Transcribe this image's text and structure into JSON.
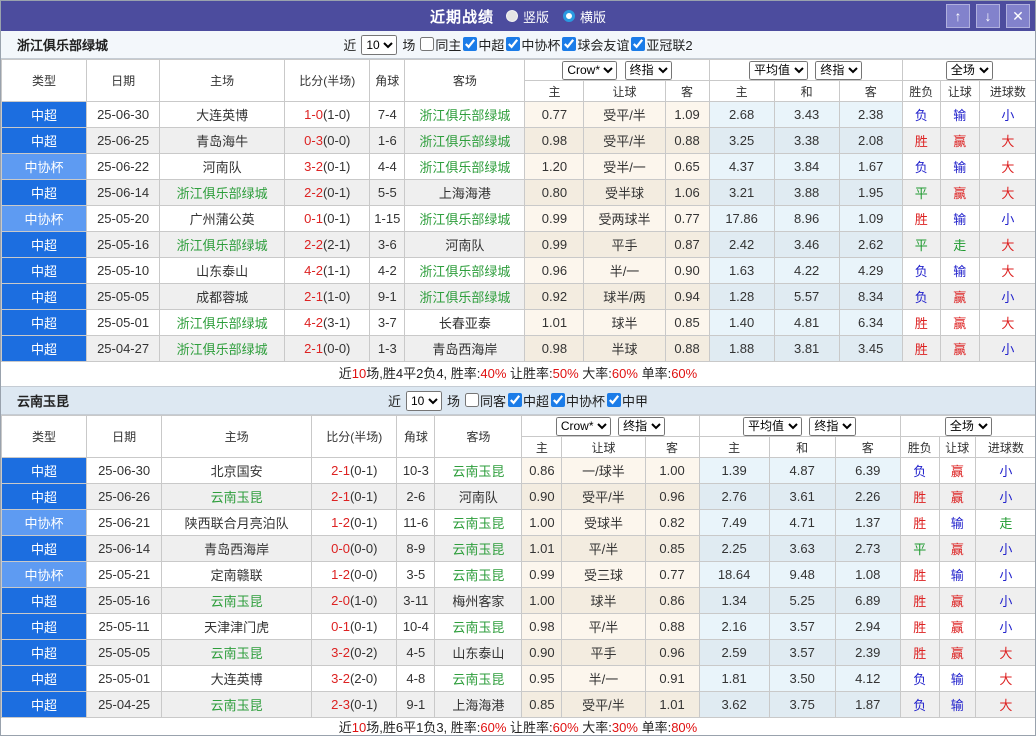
{
  "titlebar": {
    "title": "近期战绩",
    "view_options": [
      {
        "label": "竖版",
        "selected": true
      },
      {
        "label": "横版",
        "selected": false
      }
    ],
    "up_icon": "↑",
    "down_icon": "↓",
    "close_icon": "✕"
  },
  "table_header": {
    "cols": [
      "类型",
      "日期",
      "主场",
      "比分(半场)",
      "角球",
      "客场"
    ],
    "odds_sub": [
      "主",
      "让球",
      "客"
    ],
    "avg_sub": [
      "主",
      "和",
      "客"
    ],
    "result_sub": [
      "胜负",
      "让球",
      "进球数"
    ]
  },
  "colors": {
    "titlebar": "#4c4c9e",
    "league_csl": "#1c6ee0",
    "league_cup": "#5e9bf2",
    "win_red": "#dd2222",
    "lose_blue": "#2222cc",
    "draw_green": "#1f9a2f",
    "focus_team_green": "#2e9e3c"
  },
  "sections": [
    {
      "team": "浙江俱乐部绿城",
      "filter": {
        "near_label": "近",
        "count": "10",
        "unit_label": "场",
        "checkboxes": [
          {
            "label": "同主",
            "checked": false
          },
          {
            "label": "中超",
            "checked": true
          },
          {
            "label": "中协杯",
            "checked": true
          },
          {
            "label": "球会友谊",
            "checked": true
          },
          {
            "label": "亚冠联2",
            "checked": true
          }
        ]
      },
      "selects": {
        "odds_src": "Crow*",
        "odds_time": "终指",
        "avg_src": "平均值",
        "avg_time": "终指",
        "scope": "全场"
      },
      "rows": [
        {
          "type": "中超",
          "type_style": "csl",
          "date": "25-06-30",
          "home": "大连英博",
          "home_focus": false,
          "score": "1-0",
          "half": "(1-0)",
          "corner": "7-4",
          "away": "浙江俱乐部绿城",
          "away_focus": true,
          "odds": [
            "0.77",
            "受平/半",
            "1.09"
          ],
          "avg": [
            "2.68",
            "3.43",
            "2.38"
          ],
          "results": [
            {
              "t": "负",
              "c": "b"
            },
            {
              "t": "输",
              "c": "b"
            },
            {
              "t": "小",
              "c": "b"
            }
          ]
        },
        {
          "type": "中超",
          "type_style": "csl",
          "date": "25-06-25",
          "home": "青岛海牛",
          "home_focus": false,
          "score": "0-3",
          "half": "(0-0)",
          "corner": "1-6",
          "away": "浙江俱乐部绿城",
          "away_focus": true,
          "odds": [
            "0.98",
            "受平/半",
            "0.88"
          ],
          "avg": [
            "3.25",
            "3.38",
            "2.08"
          ],
          "results": [
            {
              "t": "胜",
              "c": "r"
            },
            {
              "t": "赢",
              "c": "r"
            },
            {
              "t": "大",
              "c": "r"
            }
          ]
        },
        {
          "type": "中协杯",
          "type_style": "cup",
          "date": "25-06-22",
          "home": "河南队",
          "home_focus": false,
          "score": "3-2",
          "half": "(0-1)",
          "corner": "4-4",
          "away": "浙江俱乐部绿城",
          "away_focus": true,
          "odds": [
            "1.20",
            "受半/一",
            "0.65"
          ],
          "avg": [
            "4.37",
            "3.84",
            "1.67"
          ],
          "results": [
            {
              "t": "负",
              "c": "b"
            },
            {
              "t": "输",
              "c": "b"
            },
            {
              "t": "大",
              "c": "r"
            }
          ]
        },
        {
          "type": "中超",
          "type_style": "csl",
          "date": "25-06-14",
          "home": "浙江俱乐部绿城",
          "home_focus": true,
          "score": "2-2",
          "half": "(0-1)",
          "corner": "5-5",
          "away": "上海海港",
          "away_focus": false,
          "odds": [
            "0.80",
            "受半球",
            "1.06"
          ],
          "avg": [
            "3.21",
            "3.88",
            "1.95"
          ],
          "results": [
            {
              "t": "平",
              "c": "g"
            },
            {
              "t": "赢",
              "c": "r"
            },
            {
              "t": "大",
              "c": "r"
            }
          ]
        },
        {
          "type": "中协杯",
          "type_style": "cup",
          "date": "25-05-20",
          "home": "广州蒲公英",
          "home_focus": false,
          "score": "0-1",
          "half": "(0-1)",
          "corner": "1-15",
          "away": "浙江俱乐部绿城",
          "away_focus": true,
          "odds": [
            "0.99",
            "受两球半",
            "0.77"
          ],
          "avg": [
            "17.86",
            "8.96",
            "1.09"
          ],
          "results": [
            {
              "t": "胜",
              "c": "r"
            },
            {
              "t": "输",
              "c": "b"
            },
            {
              "t": "小",
              "c": "b"
            }
          ]
        },
        {
          "type": "中超",
          "type_style": "csl",
          "date": "25-05-16",
          "home": "浙江俱乐部绿城",
          "home_focus": true,
          "score": "2-2",
          "half": "(2-1)",
          "corner": "3-6",
          "away": "河南队",
          "away_focus": false,
          "odds": [
            "0.99",
            "平手",
            "0.87"
          ],
          "avg": [
            "2.42",
            "3.46",
            "2.62"
          ],
          "results": [
            {
              "t": "平",
              "c": "g"
            },
            {
              "t": "走",
              "c": "g"
            },
            {
              "t": "大",
              "c": "r"
            }
          ]
        },
        {
          "type": "中超",
          "type_style": "csl",
          "date": "25-05-10",
          "home": "山东泰山",
          "home_focus": false,
          "score": "4-2",
          "half": "(1-1)",
          "corner": "4-2",
          "away": "浙江俱乐部绿城",
          "away_focus": true,
          "odds": [
            "0.96",
            "半/一",
            "0.90"
          ],
          "avg": [
            "1.63",
            "4.22",
            "4.29"
          ],
          "results": [
            {
              "t": "负",
              "c": "b"
            },
            {
              "t": "输",
              "c": "b"
            },
            {
              "t": "大",
              "c": "r"
            }
          ]
        },
        {
          "type": "中超",
          "type_style": "csl",
          "date": "25-05-05",
          "home": "成都蓉城",
          "home_focus": false,
          "score": "2-1",
          "half": "(1-0)",
          "corner": "9-1",
          "away": "浙江俱乐部绿城",
          "away_focus": true,
          "odds": [
            "0.92",
            "球半/两",
            "0.94"
          ],
          "avg": [
            "1.28",
            "5.57",
            "8.34"
          ],
          "results": [
            {
              "t": "负",
              "c": "b"
            },
            {
              "t": "赢",
              "c": "r"
            },
            {
              "t": "小",
              "c": "b"
            }
          ]
        },
        {
          "type": "中超",
          "type_style": "csl",
          "date": "25-05-01",
          "home": "浙江俱乐部绿城",
          "home_focus": true,
          "score": "4-2",
          "half": "(3-1)",
          "corner": "3-7",
          "away": "长春亚泰",
          "away_focus": false,
          "odds": [
            "1.01",
            "球半",
            "0.85"
          ],
          "avg": [
            "1.40",
            "4.81",
            "6.34"
          ],
          "results": [
            {
              "t": "胜",
              "c": "r"
            },
            {
              "t": "赢",
              "c": "r"
            },
            {
              "t": "大",
              "c": "r"
            }
          ]
        },
        {
          "type": "中超",
          "type_style": "csl",
          "date": "25-04-27",
          "home": "浙江俱乐部绿城",
          "home_focus": true,
          "score": "2-1",
          "half": "(0-0)",
          "corner": "1-3",
          "away": "青岛西海岸",
          "away_focus": false,
          "odds": [
            "0.98",
            "半球",
            "0.88"
          ],
          "avg": [
            "1.88",
            "3.81",
            "3.45"
          ],
          "results": [
            {
              "t": "胜",
              "c": "r"
            },
            {
              "t": "赢",
              "c": "r"
            },
            {
              "t": "小",
              "c": "b"
            }
          ]
        }
      ],
      "summary": [
        {
          "text": "近",
          "red": false
        },
        {
          "text": "10",
          "red": true
        },
        {
          "text": "场,胜4平2负4, 胜率:",
          "red": false
        },
        {
          "text": "40%",
          "red": true
        },
        {
          "text": " 让胜率:",
          "red": false
        },
        {
          "text": "50%",
          "red": true
        },
        {
          "text": " 大率:",
          "red": false
        },
        {
          "text": "60%",
          "red": true
        },
        {
          "text": " 单率:",
          "red": false
        },
        {
          "text": "60%",
          "red": true
        }
      ]
    },
    {
      "team": "云南玉昆",
      "filter": {
        "near_label": "近",
        "count": "10",
        "unit_label": "场",
        "checkboxes": [
          {
            "label": "同客",
            "checked": false
          },
          {
            "label": "中超",
            "checked": true
          },
          {
            "label": "中协杯",
            "checked": true
          },
          {
            "label": "中甲",
            "checked": true
          }
        ]
      },
      "selects": {
        "odds_src": "Crow*",
        "odds_time": "终指",
        "avg_src": "平均值",
        "avg_time": "终指",
        "scope": "全场"
      },
      "rows": [
        {
          "type": "中超",
          "type_style": "csl",
          "date": "25-06-30",
          "home": "北京国安",
          "home_focus": false,
          "score": "2-1",
          "half": "(0-1)",
          "corner": "10-3",
          "away": "云南玉昆",
          "away_focus": true,
          "odds": [
            "0.86",
            "一/球半",
            "1.00"
          ],
          "avg": [
            "1.39",
            "4.87",
            "6.39"
          ],
          "results": [
            {
              "t": "负",
              "c": "b"
            },
            {
              "t": "赢",
              "c": "r"
            },
            {
              "t": "小",
              "c": "b"
            }
          ]
        },
        {
          "type": "中超",
          "type_style": "csl",
          "date": "25-06-26",
          "home": "云南玉昆",
          "home_focus": true,
          "score": "2-1",
          "half": "(0-1)",
          "corner": "2-6",
          "away": "河南队",
          "away_focus": false,
          "odds": [
            "0.90",
            "受平/半",
            "0.96"
          ],
          "avg": [
            "2.76",
            "3.61",
            "2.26"
          ],
          "results": [
            {
              "t": "胜",
              "c": "r"
            },
            {
              "t": "赢",
              "c": "r"
            },
            {
              "t": "小",
              "c": "b"
            }
          ]
        },
        {
          "type": "中协杯",
          "type_style": "cup",
          "date": "25-06-21",
          "home": "陕西联合月亮泊队",
          "home_focus": false,
          "score": "1-2",
          "half": "(0-1)",
          "corner": "11-6",
          "away": "云南玉昆",
          "away_focus": true,
          "odds": [
            "1.00",
            "受球半",
            "0.82"
          ],
          "avg": [
            "7.49",
            "4.71",
            "1.37"
          ],
          "results": [
            {
              "t": "胜",
              "c": "r"
            },
            {
              "t": "输",
              "c": "b"
            },
            {
              "t": "走",
              "c": "g"
            }
          ]
        },
        {
          "type": "中超",
          "type_style": "csl",
          "date": "25-06-14",
          "home": "青岛西海岸",
          "home_focus": false,
          "score": "0-0",
          "half": "(0-0)",
          "corner": "8-9",
          "away": "云南玉昆",
          "away_focus": true,
          "odds": [
            "1.01",
            "平/半",
            "0.85"
          ],
          "avg": [
            "2.25",
            "3.63",
            "2.73"
          ],
          "results": [
            {
              "t": "平",
              "c": "g"
            },
            {
              "t": "赢",
              "c": "r"
            },
            {
              "t": "小",
              "c": "b"
            }
          ]
        },
        {
          "type": "中协杯",
          "type_style": "cup",
          "date": "25-05-21",
          "home": "定南赣联",
          "home_focus": false,
          "score": "1-2",
          "half": "(0-0)",
          "corner": "3-5",
          "away": "云南玉昆",
          "away_focus": true,
          "odds": [
            "0.99",
            "受三球",
            "0.77"
          ],
          "avg": [
            "18.64",
            "9.48",
            "1.08"
          ],
          "results": [
            {
              "t": "胜",
              "c": "r"
            },
            {
              "t": "输",
              "c": "b"
            },
            {
              "t": "小",
              "c": "b"
            }
          ]
        },
        {
          "type": "中超",
          "type_style": "csl",
          "date": "25-05-16",
          "home": "云南玉昆",
          "home_focus": true,
          "score": "2-0",
          "half": "(1-0)",
          "corner": "3-11",
          "away": "梅州客家",
          "away_focus": false,
          "odds": [
            "1.00",
            "球半",
            "0.86"
          ],
          "avg": [
            "1.34",
            "5.25",
            "6.89"
          ],
          "results": [
            {
              "t": "胜",
              "c": "r"
            },
            {
              "t": "赢",
              "c": "r"
            },
            {
              "t": "小",
              "c": "b"
            }
          ]
        },
        {
          "type": "中超",
          "type_style": "csl",
          "date": "25-05-11",
          "home": "天津津门虎",
          "home_focus": false,
          "score": "0-1",
          "half": "(0-1)",
          "corner": "10-4",
          "away": "云南玉昆",
          "away_focus": true,
          "odds": [
            "0.98",
            "平/半",
            "0.88"
          ],
          "avg": [
            "2.16",
            "3.57",
            "2.94"
          ],
          "results": [
            {
              "t": "胜",
              "c": "r"
            },
            {
              "t": "赢",
              "c": "r"
            },
            {
              "t": "小",
              "c": "b"
            }
          ]
        },
        {
          "type": "中超",
          "type_style": "csl",
          "date": "25-05-05",
          "home": "云南玉昆",
          "home_focus": true,
          "score": "3-2",
          "half": "(0-2)",
          "corner": "4-5",
          "away": "山东泰山",
          "away_focus": false,
          "odds": [
            "0.90",
            "平手",
            "0.96"
          ],
          "avg": [
            "2.59",
            "3.57",
            "2.39"
          ],
          "results": [
            {
              "t": "胜",
              "c": "r"
            },
            {
              "t": "赢",
              "c": "r"
            },
            {
              "t": "大",
              "c": "r"
            }
          ]
        },
        {
          "type": "中超",
          "type_style": "csl",
          "date": "25-05-01",
          "home": "大连英博",
          "home_focus": false,
          "score": "3-2",
          "half": "(2-0)",
          "corner": "4-8",
          "away": "云南玉昆",
          "away_focus": true,
          "odds": [
            "0.95",
            "半/一",
            "0.91"
          ],
          "avg": [
            "1.81",
            "3.50",
            "4.12"
          ],
          "results": [
            {
              "t": "负",
              "c": "b"
            },
            {
              "t": "输",
              "c": "b"
            },
            {
              "t": "大",
              "c": "r"
            }
          ]
        },
        {
          "type": "中超",
          "type_style": "csl",
          "date": "25-04-25",
          "home": "云南玉昆",
          "home_focus": true,
          "score": "2-3",
          "half": "(0-1)",
          "corner": "9-1",
          "away": "上海海港",
          "away_focus": false,
          "odds": [
            "0.85",
            "受平/半",
            "1.01"
          ],
          "avg": [
            "3.62",
            "3.75",
            "1.87"
          ],
          "results": [
            {
              "t": "负",
              "c": "b"
            },
            {
              "t": "输",
              "c": "b"
            },
            {
              "t": "大",
              "c": "r"
            }
          ]
        }
      ],
      "summary": [
        {
          "text": "近",
          "red": false
        },
        {
          "text": "10",
          "red": true
        },
        {
          "text": "场,胜6平1负3, 胜率:",
          "red": false
        },
        {
          "text": "60%",
          "red": true
        },
        {
          "text": " 让胜率:",
          "red": false
        },
        {
          "text": "60%",
          "red": true
        },
        {
          "text": " 大率:",
          "red": false
        },
        {
          "text": "30%",
          "red": true
        },
        {
          "text": " 单率:",
          "red": false
        },
        {
          "text": "80%",
          "red": true
        }
      ]
    }
  ]
}
